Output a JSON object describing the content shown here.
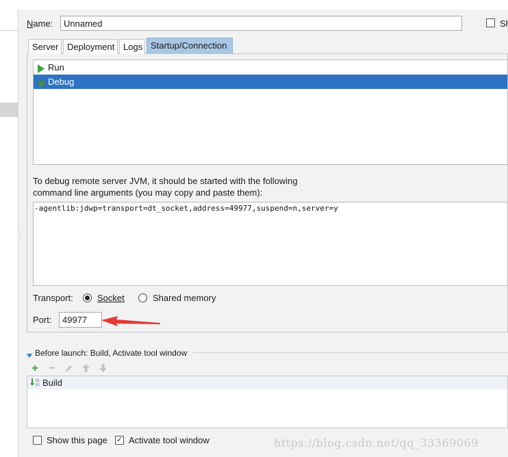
{
  "name_field": {
    "label": "Name:",
    "value": "Unnamed"
  },
  "share_checkbox": {
    "label": "Sh",
    "checked": false
  },
  "tabs": [
    {
      "label": "Server",
      "active": false
    },
    {
      "label": "Deployment",
      "active": false
    },
    {
      "label": "Logs",
      "active": false
    },
    {
      "label": "Startup/Connection",
      "active": true
    }
  ],
  "modes": [
    {
      "label": "Run",
      "icon": "run-icon",
      "selected": false
    },
    {
      "label": "Debug",
      "icon": "debug-icon",
      "selected": true
    }
  ],
  "debug_info": {
    "line1": "To debug remote server JVM, it should be started with the following",
    "line2": "command line arguments (you may copy and paste them):",
    "args": "-agentlib:jdwp=transport=dt_socket,address=49977,suspend=n,server=y"
  },
  "transport": {
    "label": "Transport:",
    "options": [
      {
        "label": "Socket",
        "selected": true
      },
      {
        "label": "Shared memory",
        "selected": false
      }
    ]
  },
  "port": {
    "label": "Port:",
    "value": "49977"
  },
  "before_launch": {
    "title": "Before launch: Build, Activate tool window",
    "items": [
      {
        "label": "Build",
        "icon": "build-icon"
      }
    ]
  },
  "bottom_options": {
    "show_page": {
      "label": "Show this page",
      "checked": false
    },
    "activate_tool_window": {
      "label": "Activate tool window",
      "checked": true
    }
  },
  "watermark": "https://blog.csdn.net/qq_33369069",
  "colors": {
    "selection": "#2e73c4",
    "active_tab": "#a9c7e4",
    "arrow": "#e53935",
    "add_icon": "#3c9a3c"
  }
}
